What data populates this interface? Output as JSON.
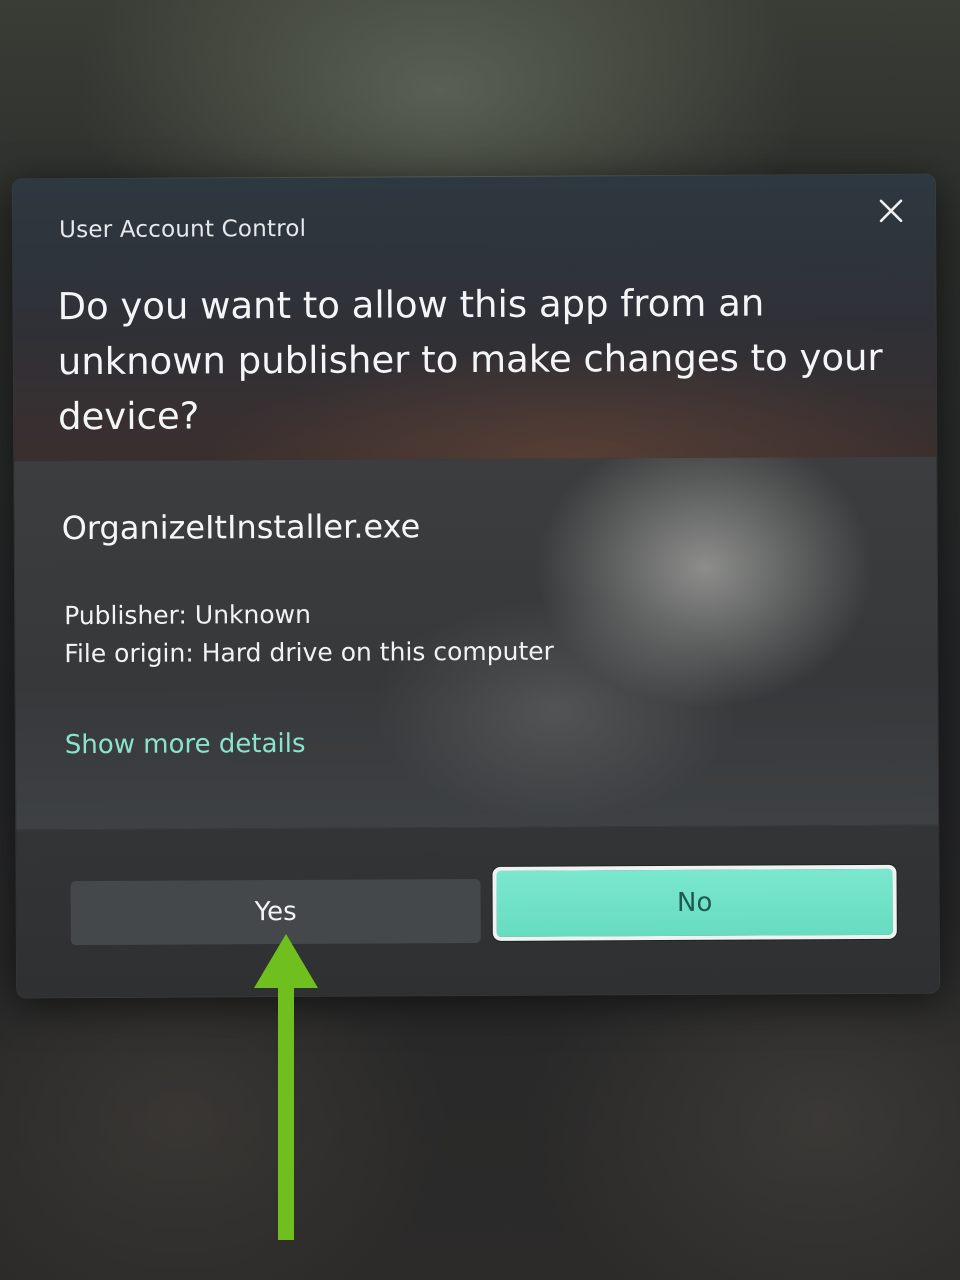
{
  "dialog": {
    "title": "User Account Control",
    "question": "Do you want to allow this app from an unknown publisher to make changes to your device?",
    "filename": "OrganizeItInstaller.exe",
    "publisher_line": "Publisher: Unknown",
    "origin_line": "File origin: Hard drive on this computer",
    "more_details_link": "Show more details",
    "buttons": {
      "yes": "Yes",
      "no": "No"
    }
  },
  "icons": {
    "close": "close-icon",
    "annotation_arrow": "arrow-up-icon"
  },
  "colors": {
    "accent": "#66dcc0",
    "link": "#8be3cf",
    "annotation": "#6fbf1f"
  }
}
